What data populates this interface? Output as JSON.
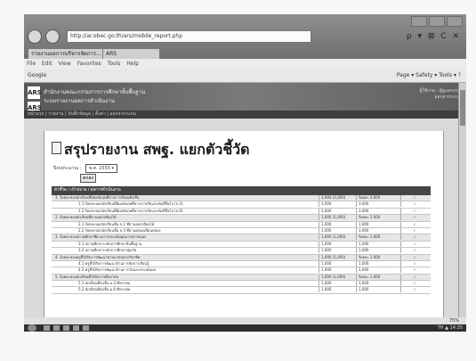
{
  "browser": {
    "address": "http://ar.obec.go.th/ars/mobile_report.php",
    "address_icons": "ρ ▾ ⊠ C ✕",
    "tabs": [
      {
        "label": "รายงานผลการบริหารจัดการ..."
      },
      {
        "label": "ARS"
      }
    ],
    "menu": [
      "File",
      "Edit",
      "View",
      "Favorites",
      "Tools",
      "Help"
    ],
    "favorites": "Google",
    "toolbar_right": "Page ▾  Safety ▾  Tools ▾  ?"
  },
  "banner": {
    "logo": "ARS",
    "logo2": "ARS",
    "org_line1": "สำนักงานคณะกรรมการการศึกษาขั้นพื้นฐาน",
    "org_line2": "ระบบรายงานผลการดำเนินงาน",
    "right_line1": "ผู้ใช้งาน : ผู้ดูแลระบบ",
    "right_line2": "ออกจากระบบ",
    "nav": "หน้าแรก  |  รายงาน  |  บันทึกข้อมูล  |  ตั้งค่า  |  ออกจากระบบ"
  },
  "page": {
    "title": "สรุปรายงาน สพฐ. แยกตัวชี้วัด",
    "filter_label": "ปีงบประมาณ :",
    "filter_value": "พ.ศ. 2555",
    "ok_label": "ตกลง",
    "table_header": "ตัวชี้วัด / เป้าหมาย / ผลการดำเนินงาน",
    "rows": [
      {
        "type": "group",
        "text": "1. ร้อยละของนักเรียนที่มีผลสัมฤทธิ์ทางการเรียนเพิ่มขึ้น",
        "v1": "3,000 (3,000)",
        "v2": "ร้อยละ 3.000",
        "v3": "✓"
      },
      {
        "type": "sub",
        "text": "1.1 ร้อยละของนักเรียนที่มีผลสัมฤทธิ์ทางการเรียนระดับดีขึ้นไป (ป.3)",
        "v1": "3,000",
        "v2": "3,000",
        "v3": "✓"
      },
      {
        "type": "sub",
        "text": "1.2 ร้อยละของนักเรียนที่มีผลสัมฤทธิ์ทางการเรียนระดับดีขึ้นไป (ป.6)",
        "v1": "3,000",
        "v2": "3,000",
        "v3": "✓"
      },
      {
        "type": "group",
        "text": "2. ร้อยละของนักเรียนที่อ่านออกเขียนได้",
        "v1": "1,000 (1,000)",
        "v2": "ร้อยละ 1.000",
        "v3": "✓"
      },
      {
        "type": "sub",
        "text": "2.1 ร้อยละของนักเรียนชั้น ป.1 ที่อ่านออกเขียนได้",
        "v1": "1,000",
        "v2": "1,000",
        "v3": "✓"
      },
      {
        "type": "sub",
        "text": "2.2 ร้อยละของนักเรียนชั้น ป.3 ที่อ่านคล่องเขียนคล่อง",
        "v1": "1,000",
        "v2": "1,000",
        "v3": "✓"
      },
      {
        "type": "group",
        "text": "3. ร้อยละของสถานศึกษาที่ผ่านการประเมินคุณภาพภายนอก",
        "v1": "1,000 (1,000)",
        "v2": "ร้อยละ 1.000",
        "v3": "✓"
      },
      {
        "type": "sub",
        "text": "3.1 สถานศึกษาระดับการศึกษาขั้นพื้นฐาน",
        "v1": "1,000",
        "v2": "1,000",
        "v3": "✓"
      },
      {
        "type": "sub",
        "text": "3.2 สถานศึกษาระดับการศึกษาปฐมวัย",
        "v1": "1,000",
        "v2": "1,000",
        "v3": "✓"
      },
      {
        "type": "group",
        "text": "4. ร้อยละของครูที่ได้รับการพัฒนาตามมาตรฐานวิชาชีพ",
        "v1": "1,000 (1,000)",
        "v2": "ร้อยละ 1.000",
        "v3": "✓"
      },
      {
        "type": "sub",
        "text": "4.1 ครูที่ได้รับการพัฒนาด้านการจัดการเรียนรู้",
        "v1": "1,000",
        "v2": "1,000",
        "v3": "✓"
      },
      {
        "type": "sub",
        "text": "4.2 ครูที่ได้รับการพัฒนาด้านการวัดและประเมินผล",
        "v1": "1,000",
        "v2": "1,000",
        "v3": "✓"
      },
      {
        "type": "group",
        "text": "5. ร้อยละของนักเรียนที่ได้รับการศึกษาต่อ",
        "v1": "1,000 (1,000)",
        "v2": "ร้อยละ 1.000",
        "v3": "✓"
      },
      {
        "type": "sub",
        "text": "5.1 นักเรียนที่จบชั้น ม.3 ศึกษาต่อ",
        "v1": "1,000",
        "v2": "1,000",
        "v3": "✓"
      },
      {
        "type": "sub",
        "text": "5.2 นักเรียนที่จบชั้น ม.6 ศึกษาต่อ",
        "v1": "1,000",
        "v2": "1,000",
        "v3": "✓"
      }
    ]
  },
  "status": {
    "zoom": "75%"
  },
  "taskbar": {
    "clock": "TH ▲ 14:35"
  }
}
